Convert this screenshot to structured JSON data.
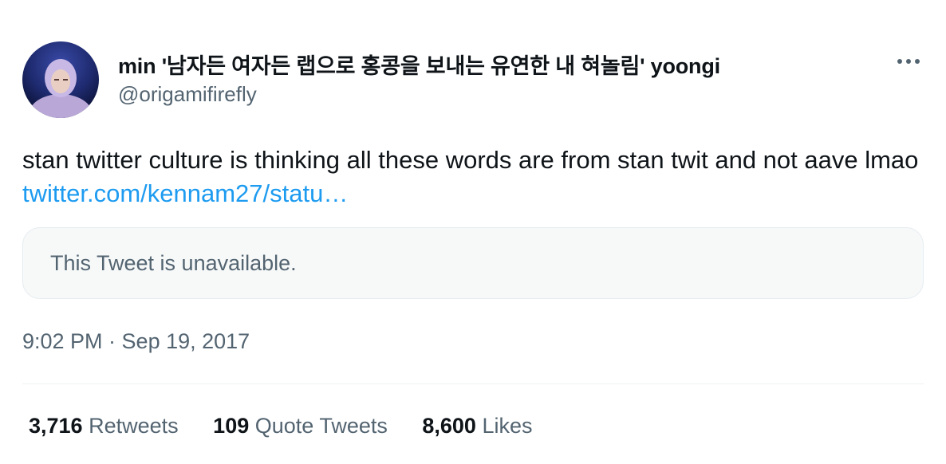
{
  "author": {
    "display_name": "min '남자든 여자든 랩으로 홍콩을 보내는 유연한 내 혀놀림' yoongi",
    "handle": "@origamifirefly",
    "avatar_icon": "user-avatar"
  },
  "tweet": {
    "text": "stan twitter culture is thinking all these words are from stan twit and not aave lmao ",
    "link_text": "twitter.com/kennam27/statu…",
    "timestamp": "9:02 PM · Sep 19, 2017"
  },
  "quote": {
    "text": "This Tweet is unavailable."
  },
  "stats": {
    "retweets_count": "3,716",
    "retweets_label": "Retweets",
    "quote_tweets_count": "109",
    "quote_tweets_label": "Quote Tweets",
    "likes_count": "8,600",
    "likes_label": "Likes"
  },
  "colors": {
    "link": "#1d9bf0",
    "secondary_text": "#536471",
    "primary_text": "#0f1419"
  },
  "icons": {
    "more": "more-horizontal-icon"
  }
}
